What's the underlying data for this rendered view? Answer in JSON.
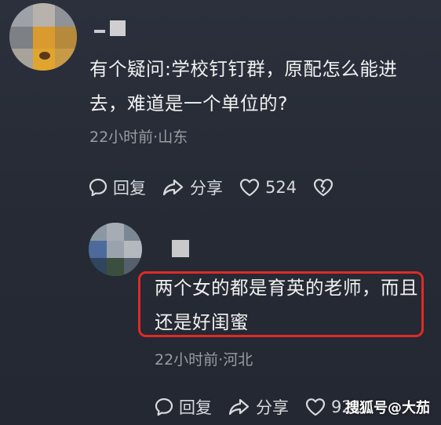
{
  "comment1": {
    "text": "有个疑问:学校钉钉群，原配怎么能进去，难道是一个单位的?",
    "meta": "22小时前·山东",
    "reply_label": "回复",
    "share_label": "分享",
    "like_count": "524"
  },
  "comment2": {
    "text": "两个女的都是育英的老师，而且还是好闺蜜",
    "meta": "22小时前·河北",
    "reply_label": "回复",
    "share_label": "分享",
    "like_count": "921"
  },
  "watermark": "搜狐号@大茄",
  "colors": {
    "background": "#262b36",
    "highlight_border": "#e02a25",
    "meta_text": "#9a9ca2"
  }
}
